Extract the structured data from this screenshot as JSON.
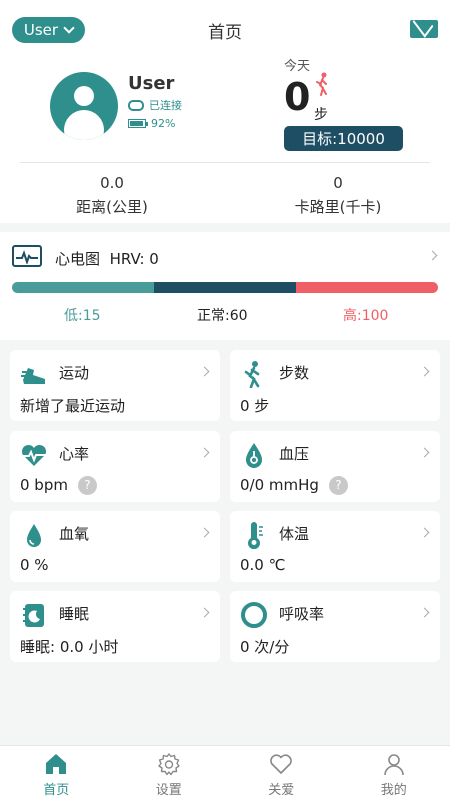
{
  "header": {
    "user_menu": "User",
    "title": "首页"
  },
  "profile": {
    "name": "User",
    "connection": "已连接",
    "battery": "92%",
    "battery_level": 0.92
  },
  "today": {
    "label": "今天",
    "steps": "0",
    "unit": "步",
    "goal": "目标:10000"
  },
  "stats": {
    "distance_value": "0.0",
    "distance_label": "距离(公里)",
    "calories_value": "0",
    "calories_label": "卡路里(千卡)"
  },
  "ecg": {
    "title": "心电图",
    "hrv": "HRV: 0",
    "low": "低:15",
    "normal": "正常:60",
    "high": "高:100",
    "colors": {
      "low": "#4a9c9a",
      "normal": "#1d4e63",
      "high": "#f05f66"
    }
  },
  "cards": {
    "exercise": {
      "title": "运动",
      "value": "新增了最近运动"
    },
    "steps": {
      "title": "步数",
      "value": "0 步"
    },
    "heart_rate": {
      "title": "心率",
      "value": "0 bpm",
      "help": "?"
    },
    "blood_pressure": {
      "title": "血压",
      "value": "0/0 mmHg",
      "help": "?"
    },
    "spo2": {
      "title": "血氧",
      "value": "0 %"
    },
    "temperature": {
      "title": "体温",
      "value": "0.0 ℃"
    },
    "sleep": {
      "title": "睡眠",
      "value": "睡眠: 0.0 小时"
    },
    "respiration": {
      "title": "呼吸率",
      "value": "0 次/分"
    }
  },
  "nav": {
    "home": "首页",
    "settings": "设置",
    "care": "关爱",
    "mine": "我的"
  },
  "colors": {
    "accent": "#2f8f8d",
    "dark": "#1d4e63"
  }
}
